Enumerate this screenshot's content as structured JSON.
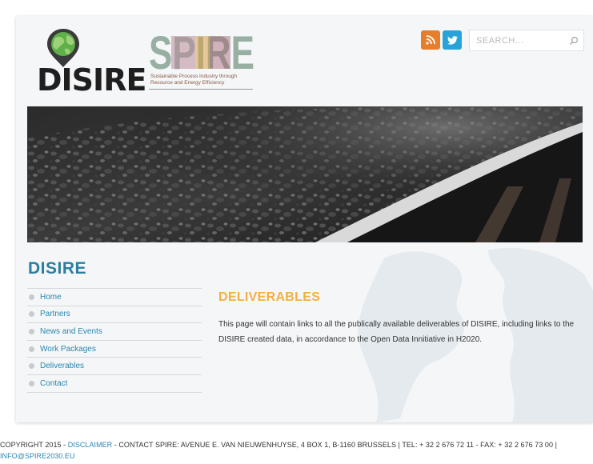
{
  "header": {
    "logo_text": "DISIRE",
    "spire_logo_text": "SPIRE",
    "spire_tagline": "Sustainable Process Industry through Resource and Energy Efficiency",
    "social": {
      "rss_icon": "rss-icon",
      "twitter_icon": "twitter-icon"
    },
    "search": {
      "placeholder": "SEARCH...",
      "value": ""
    }
  },
  "sidebar": {
    "title": "DISIRE",
    "items": [
      {
        "label": "Home"
      },
      {
        "label": "Partners"
      },
      {
        "label": "News and Events"
      },
      {
        "label": "Work Packages"
      },
      {
        "label": "Deliverables"
      },
      {
        "label": "Contact"
      }
    ]
  },
  "main": {
    "heading": "DELIVERABLES",
    "body": "This page will contain links to all the publically available deliverables of DISIRE, including links to the DISIRE created data, in accordance to the Open Data Innitiative in H2020."
  },
  "footer": {
    "copyright": "COPYRIGHT 2015 - ",
    "disclaimer": "DISCLAIMER",
    "contact": " - CONTACT SPIRE: AVENUE E. VAN NIEUWENHUYSE, 4 BOX 1, B-1160 BRUSSELS | TEL: + 32 2 676 72 11 - FAX: + 32 2 676 73 00 | ",
    "email": "INFO@SPIRE2030.EU"
  },
  "colors": {
    "accent_blue": "#2b86b0",
    "title_blue": "#2a7fa0",
    "heading_orange": "#f2b13c",
    "rss_orange": "#e67f2d",
    "twitter_blue": "#27a3da"
  }
}
